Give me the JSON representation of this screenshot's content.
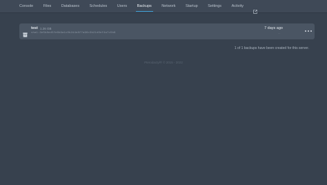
{
  "nav": {
    "tabs": [
      {
        "label": "Console"
      },
      {
        "label": "Files"
      },
      {
        "label": "Databases"
      },
      {
        "label": "Schedules"
      },
      {
        "label": "Users"
      },
      {
        "label": "Backups"
      },
      {
        "label": "Network"
      },
      {
        "label": "Startup"
      },
      {
        "label": "Settings"
      },
      {
        "label": "Activity"
      }
    ],
    "active_tab": "Backups",
    "external_icon": "external-link-icon"
  },
  "backup": {
    "name": "test",
    "size": "1.26 GB",
    "hash": "sha1:3e5b8ed5fe6b9a1c0b2d4e8f7a96c3b21d0ef4a7c5b8",
    "created": "7 days ago",
    "created_sub": "...",
    "icon": "archive-icon",
    "menu_icon": "more-horizontal-icon"
  },
  "count_text": "1 of 1 backups have been created for this server.",
  "footer": "Pterodactyl® © 2015 - 2022",
  "colors": {
    "background": "#37414e",
    "card": "#4a5563",
    "accent": "#3ea0d6"
  }
}
